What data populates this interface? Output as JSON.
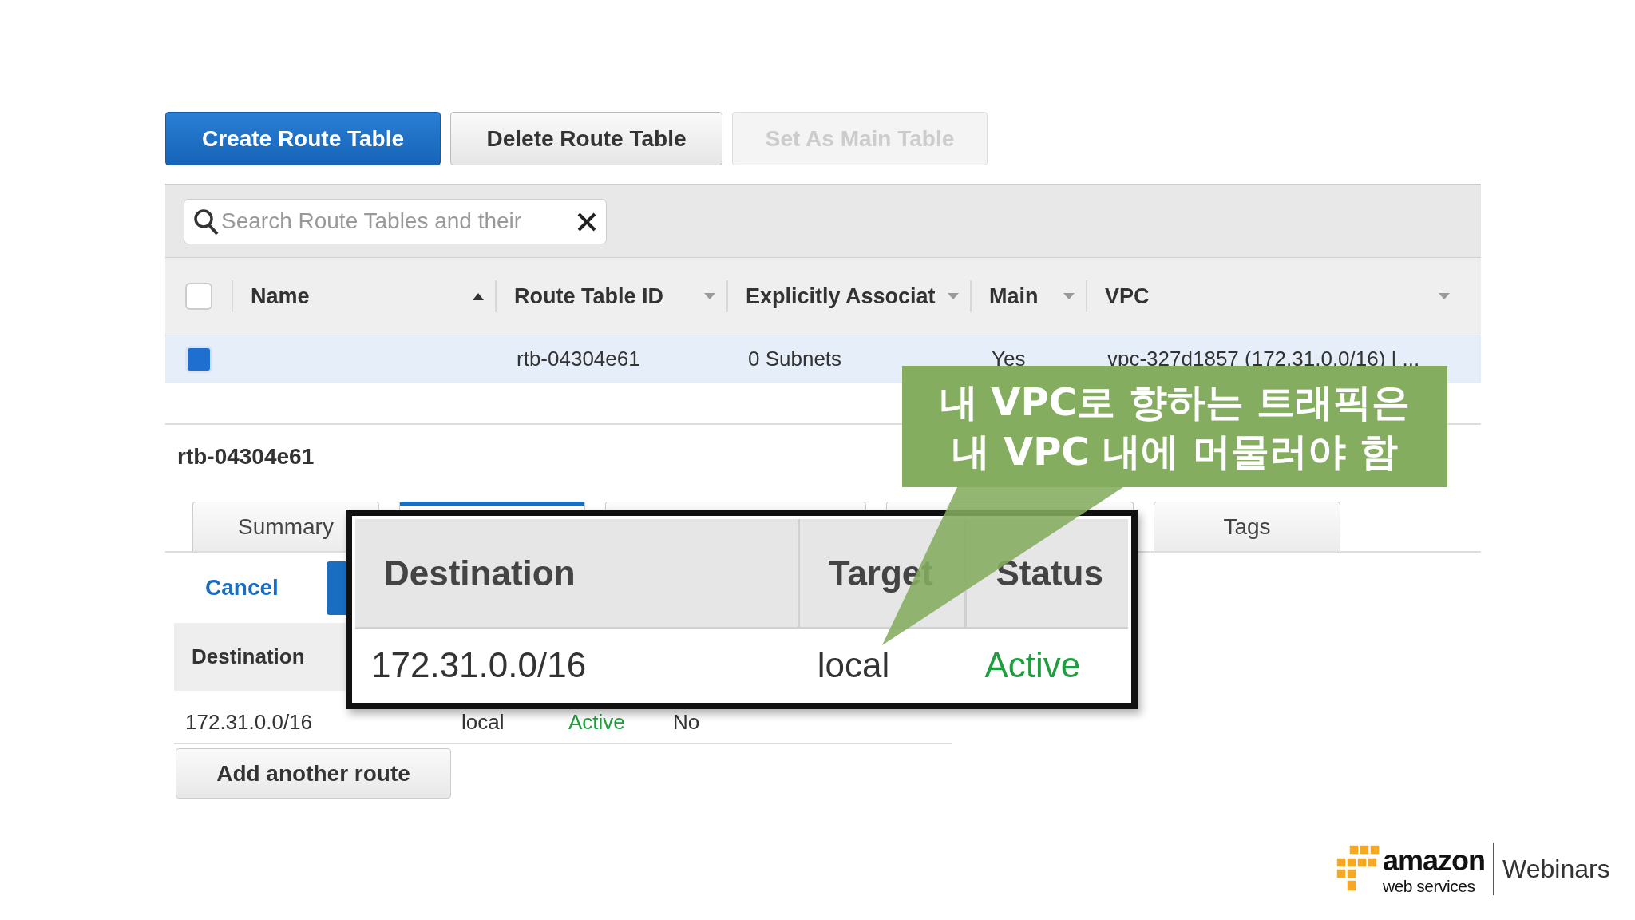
{
  "toolbar_buttons": [
    {
      "label": "Create Route Table",
      "kind": "primary",
      "disabled": false
    },
    {
      "label": "Delete Route Table",
      "kind": "default",
      "disabled": false
    },
    {
      "label": "Set As Main Table",
      "kind": "default",
      "disabled": true
    }
  ],
  "search": {
    "placeholder": "Search Route Tables and their"
  },
  "table": {
    "select_all": {
      "checked": false
    },
    "columns": [
      {
        "label": "Name",
        "sorted": true
      },
      {
        "label": "Route Table ID",
        "sorted": false
      },
      {
        "label": "Explicitly Associat",
        "sorted": false
      },
      {
        "label": "Main",
        "sorted": false
      },
      {
        "label": "VPC",
        "sorted": false
      }
    ],
    "rows": [
      {
        "selected": true,
        "route_table_id": "rtb-04304e61",
        "associations": "0 Subnets",
        "main": "Yes",
        "vpc": "vpc-327d1857 (172.31.0.0/16) | ..."
      }
    ]
  },
  "details": {
    "title": "rtb-04304e61",
    "tabs": [
      {
        "label": "Summary",
        "selected": false
      },
      {
        "selected": true
      },
      {
        "selected": false
      },
      {
        "selected": false
      },
      {
        "label": "Tags",
        "selected": false
      }
    ],
    "actions": [
      {
        "label": "Cancel",
        "kind": "link"
      },
      {
        "kind": "primary"
      }
    ],
    "routes": {
      "columns": [
        "Destination"
      ],
      "rows": [
        {
          "destination": "172.31.0.0/16",
          "target": "local",
          "status": "Active",
          "propagated": "No"
        }
      ]
    },
    "add_button": "Add another route"
  },
  "zoom_inset": {
    "columns": [
      "Destination",
      "Target",
      "Status"
    ],
    "row": {
      "destination": "172.31.0.0/16",
      "target": "local",
      "status": "Active"
    }
  },
  "annotation": {
    "lines": [
      "내 VPC로 향하는 트래픽은",
      "내 VPC 내에 머물러야 함"
    ]
  },
  "brand": {
    "logo_top": "amazon",
    "logo_bottom": "web services",
    "label": "Webinars"
  }
}
